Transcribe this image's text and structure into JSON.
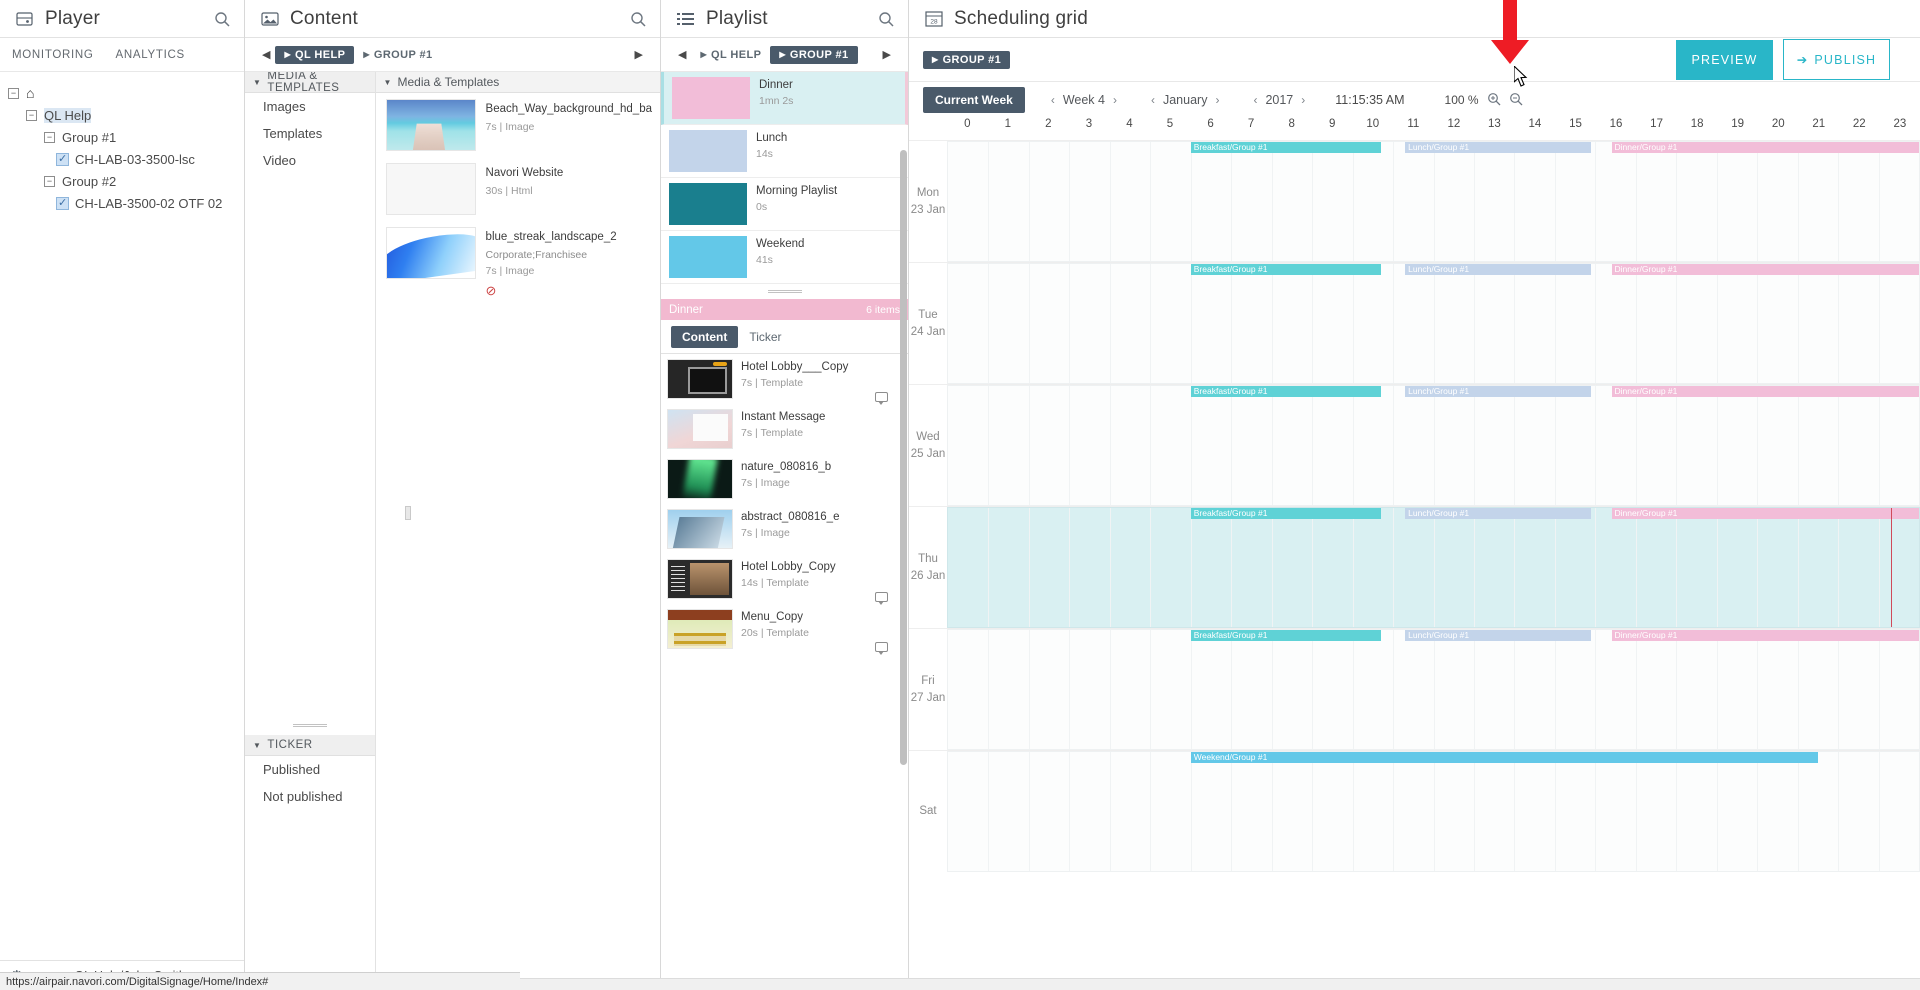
{
  "player": {
    "title": "Player",
    "icon": "player-icon",
    "search_icon": "search-icon",
    "tabs": [
      {
        "label": "MONITORING"
      },
      {
        "label": "ANALYTICS"
      }
    ],
    "tree": [
      {
        "label": "",
        "icon": "home-icon",
        "level": 0,
        "expander": "−",
        "checkbox": false
      },
      {
        "label": "QL Help",
        "level": 1,
        "expander": "−",
        "checkbox": false,
        "selected": true
      },
      {
        "label": "Group #1",
        "level": 2,
        "expander": "−",
        "checkbox": false
      },
      {
        "label": "CH-LAB-03-3500-lsc",
        "level": 3,
        "expander": "",
        "checkbox": true
      },
      {
        "label": "Group #2",
        "level": 2,
        "expander": "−",
        "checkbox": false
      },
      {
        "label": "CH-LAB-3500-02 OTF 02",
        "level": 3,
        "expander": "",
        "checkbox": true
      }
    ],
    "footer": {
      "gear_icon": "gear-icon",
      "caret_icon": "caret-up-icon",
      "user_path": "QL Help/John Smith"
    }
  },
  "content": {
    "title": "Content",
    "icon": "content-image-icon",
    "search_icon": "search-icon",
    "breadcrumb": {
      "left_arrow": "◀",
      "right_arrow": "▶",
      "items": [
        {
          "label": "QL HELP",
          "active": true
        },
        {
          "label": "GROUP #1",
          "active": false
        }
      ]
    },
    "left_sections": [
      {
        "header": "MEDIA & TEMPLATES",
        "items": [
          "Images",
          "Templates",
          "Video"
        ]
      },
      {
        "header": "TICKER",
        "items": [
          "Published",
          "Not published"
        ]
      }
    ],
    "list_header": "Media & Templates",
    "media_items": [
      {
        "name": "Beach_Way_background_hd_ba",
        "duration": "7s",
        "type": "Image",
        "tags": "",
        "art": "art-beach",
        "no_icon": false
      },
      {
        "name": "Navori Website",
        "duration": "30s",
        "type": "Html",
        "tags": "",
        "art": "art-blank",
        "no_icon": false
      },
      {
        "name": "blue_streak_landscape_2",
        "duration": "7s",
        "type": "Image",
        "tags": "Corporate;Franchisee",
        "art": "art-blue",
        "no_icon": true
      }
    ]
  },
  "playlist": {
    "title": "Playlist",
    "icon": "list-icon",
    "search_icon": "search-icon",
    "breadcrumb": {
      "left_arrow": "◀",
      "right_arrow": "▶",
      "items": [
        {
          "label": "QL HELP",
          "active": false
        },
        {
          "label": "GROUP #1",
          "active": true
        }
      ]
    },
    "items": [
      {
        "name": "Dinner",
        "duration": "1mn 2s",
        "color": "#f2bdd8",
        "selected": true
      },
      {
        "name": "Lunch",
        "duration": "14s",
        "color": "#c3d4ea",
        "selected": false
      },
      {
        "name": "Morning Playlist",
        "duration": "0s",
        "color": "#1a7f8e",
        "selected": false
      },
      {
        "name": "Weekend",
        "duration": "41s",
        "color": "#63c8e8",
        "selected": false
      }
    ],
    "detail": {
      "header_name": "Dinner",
      "header_count": "6 items",
      "tabs": [
        {
          "label": "Content",
          "active": true
        },
        {
          "label": "Ticker",
          "active": false
        }
      ],
      "content_items": [
        {
          "name": "Hotel Lobby___Copy",
          "duration": "7s",
          "type": "Template",
          "art": "art-dark",
          "bubble": true
        },
        {
          "name": "Instant Message",
          "duration": "7s",
          "type": "Template",
          "art": "art-hand",
          "bubble": false
        },
        {
          "name": "nature_080816_b",
          "duration": "7s",
          "type": "Image",
          "art": "art-aurora",
          "bubble": false
        },
        {
          "name": "abstract_080816_e",
          "duration": "7s",
          "type": "Image",
          "art": "art-abstract",
          "bubble": false
        },
        {
          "name": "Hotel Lobby_Copy",
          "duration": "14s",
          "type": "Template",
          "art": "art-lobby",
          "bubble": true
        },
        {
          "name": "Menu_Copy",
          "duration": "20s",
          "type": "Template",
          "art": "art-menu",
          "bubble": true
        }
      ]
    }
  },
  "scheduling": {
    "title": "Scheduling grid",
    "icon": "calendar-icon",
    "calendar_day": "28",
    "breadcrumb": {
      "items": [
        {
          "label": "GROUP #1",
          "active": true
        }
      ]
    },
    "actions": {
      "preview_label": "PREVIEW",
      "publish_label": "PUBLISH",
      "publish_icon": "publish-arrow-icon",
      "preview_color": "#29b6c8",
      "publish_color": "#29b6c8"
    },
    "toolbar": {
      "current_week_label": "Current Week",
      "week_label": "Week 4",
      "month_label": "January",
      "year_label": "2017",
      "time_label": "11:15:35 AM",
      "zoom_label": "100 %",
      "zoom_in_icon": "zoom-in-icon",
      "zoom_out_icon": "zoom-out-icon",
      "prev_icon": "chevron-left-icon",
      "next_icon": "chevron-right-icon"
    },
    "hours": [
      "0",
      "1",
      "2",
      "3",
      "4",
      "5",
      "6",
      "7",
      "8",
      "9",
      "10",
      "11",
      "12",
      "13",
      "14",
      "15",
      "16",
      "17",
      "18",
      "19",
      "20",
      "21",
      "22",
      "23"
    ],
    "days": [
      {
        "day": "Mon",
        "date": "23 Jan",
        "highlighted": false,
        "events": [
          {
            "label": "Breakfast/Group #1",
            "start": 6.0,
            "end": 10.7,
            "color": "#5fd2d6"
          },
          {
            "label": "Lunch/Group #1",
            "start": 11.3,
            "end": 15.9,
            "color": "#c3d4ea"
          },
          {
            "label": "Dinner/Group #1",
            "start": 16.4,
            "end": 24.0,
            "color": "#f2bdd8"
          }
        ]
      },
      {
        "day": "Tue",
        "date": "24 Jan",
        "highlighted": false,
        "events": [
          {
            "label": "Breakfast/Group #1",
            "start": 6.0,
            "end": 10.7,
            "color": "#5fd2d6"
          },
          {
            "label": "Lunch/Group #1",
            "start": 11.3,
            "end": 15.9,
            "color": "#c3d4ea"
          },
          {
            "label": "Dinner/Group #1",
            "start": 16.4,
            "end": 24.0,
            "color": "#f2bdd8"
          }
        ]
      },
      {
        "day": "Wed",
        "date": "25 Jan",
        "highlighted": false,
        "events": [
          {
            "label": "Breakfast/Group #1",
            "start": 6.0,
            "end": 10.7,
            "color": "#5fd2d6"
          },
          {
            "label": "Lunch/Group #1",
            "start": 11.3,
            "end": 15.9,
            "color": "#c3d4ea"
          },
          {
            "label": "Dinner/Group #1",
            "start": 16.4,
            "end": 24.0,
            "color": "#f2bdd8"
          }
        ]
      },
      {
        "day": "Thu",
        "date": "26 Jan",
        "highlighted": true,
        "events": [
          {
            "label": "Breakfast/Group #1",
            "start": 6.0,
            "end": 10.7,
            "color": "#5fd2d6"
          },
          {
            "label": "Lunch/Group #1",
            "start": 11.3,
            "end": 15.9,
            "color": "#c3d4ea"
          },
          {
            "label": "Dinner/Group #1",
            "start": 16.4,
            "end": 24.0,
            "color": "#f2bdd8"
          }
        ],
        "now_marker": 23.3
      },
      {
        "day": "Fri",
        "date": "27 Jan",
        "highlighted": false,
        "events": [
          {
            "label": "Breakfast/Group #1",
            "start": 6.0,
            "end": 10.7,
            "color": "#5fd2d6"
          },
          {
            "label": "Lunch/Group #1",
            "start": 11.3,
            "end": 15.9,
            "color": "#c3d4ea"
          },
          {
            "label": "Dinner/Group #1",
            "start": 16.4,
            "end": 24.0,
            "color": "#f2bdd8"
          }
        ]
      },
      {
        "day": "Sat",
        "date": "",
        "highlighted": false,
        "events": [
          {
            "label": "Weekend/Group #1",
            "start": 6.0,
            "end": 21.5,
            "color": "#63c8e8"
          }
        ]
      }
    ]
  },
  "statusbar": {
    "url": "https://airpair.navori.com/DigitalSignage/Home/Index#"
  }
}
